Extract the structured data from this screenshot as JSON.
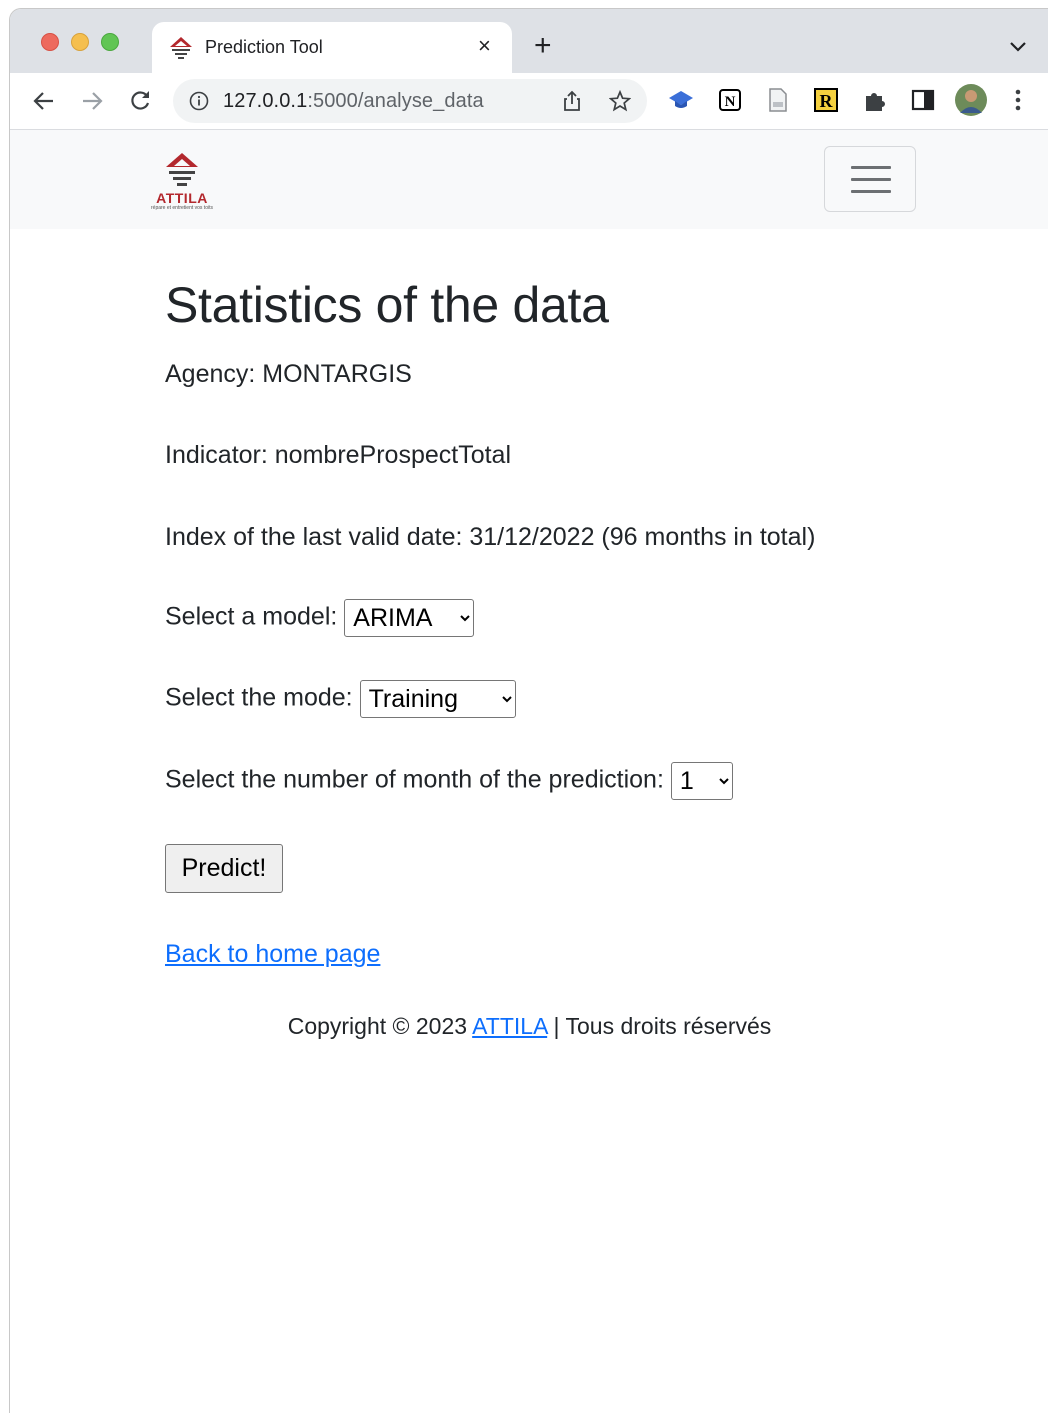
{
  "browser": {
    "tab_title": "Prediction Tool",
    "tab_close": "×",
    "new_tab": "+",
    "url_host": "127.0.0.1",
    "url_path": ":5000/analyse_data"
  },
  "navbar": {
    "brand_name": "ATTILA",
    "brand_tagline": "répare et entretient vos toits"
  },
  "main": {
    "title": "Statistics of the data",
    "agency": "Agency: MONTARGIS",
    "indicator": "Indicator: nombreProspectTotal",
    "last_date": "Index of the last valid date: 31/12/2022 (96 months in total)",
    "model_label": "Select a model:",
    "model_value": "ARIMA",
    "mode_label": "Select the mode:",
    "mode_value": "Training",
    "months_label": "Select the number of month of the prediction:",
    "months_value": "1",
    "predict_button": "Predict!",
    "home_link": "Back to home page"
  },
  "footer": {
    "prefix": "Copyright © 2023 ",
    "link": "ATTILA",
    "suffix": " | Tous droits réservés"
  },
  "colors": {
    "link": "#0d6efd",
    "brand_red": "#b3282d",
    "navbar_bg": "#f8f9fa"
  }
}
